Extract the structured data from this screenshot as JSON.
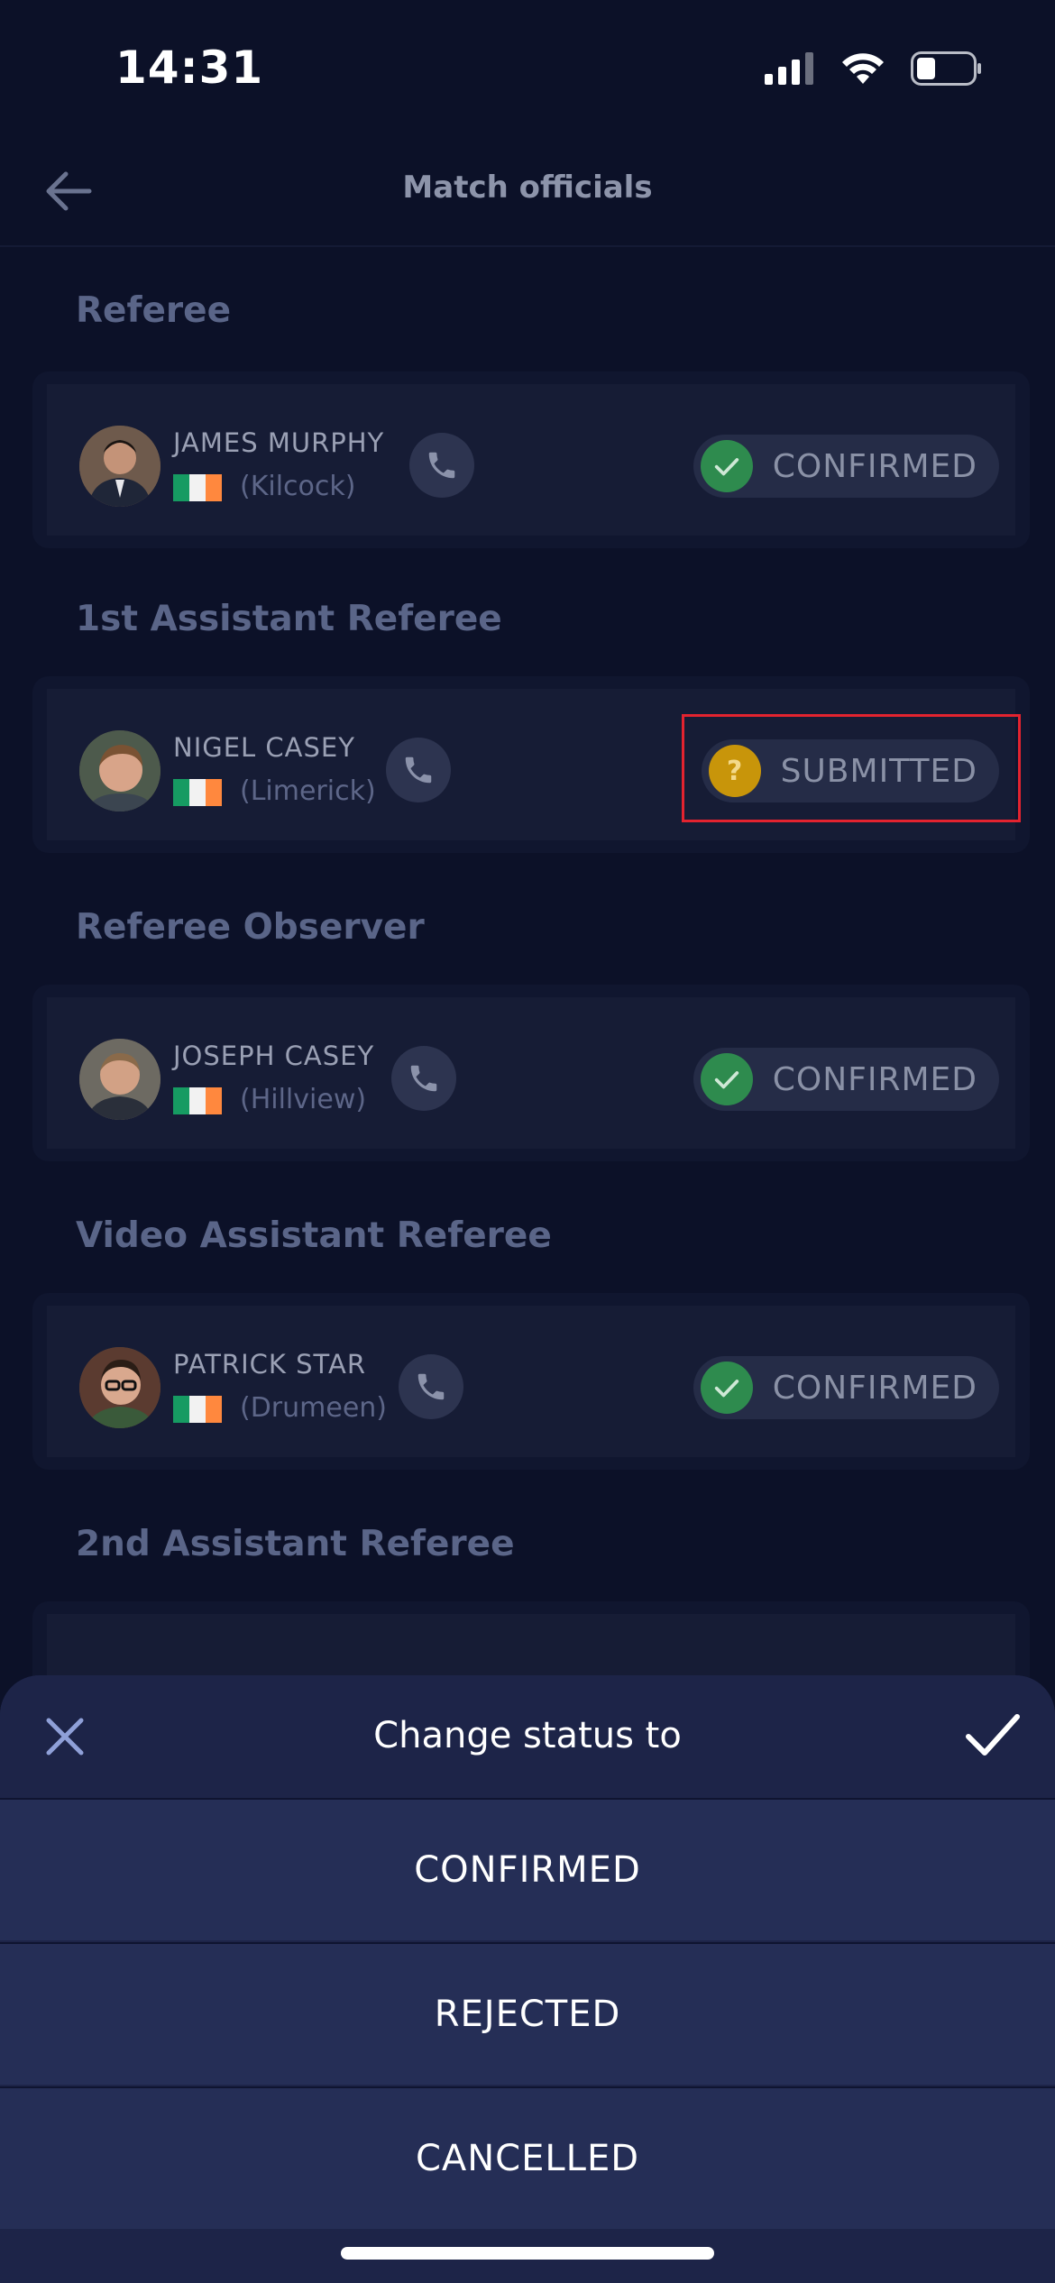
{
  "status_bar": {
    "time": "14:31"
  },
  "header": {
    "title": "Match officials"
  },
  "sections": [
    {
      "label": "Referee",
      "official": {
        "name": "JAMES MURPHY",
        "club": "(Kilcock)",
        "status": "CONFIRMED"
      }
    },
    {
      "label": "1st Assistant Referee",
      "official": {
        "name": "NIGEL CASEY",
        "club": "(Limerick)",
        "status": "SUBMITTED"
      }
    },
    {
      "label": "Referee Observer",
      "official": {
        "name": "JOSEPH CASEY",
        "club": "(Hillview)",
        "status": "CONFIRMED"
      }
    },
    {
      "label": "Video Assistant Referee",
      "official": {
        "name": "PATRICK STAR",
        "club": "(Drumeen)",
        "status": "CONFIRMED"
      }
    },
    {
      "label": "2nd Assistant Referee"
    }
  ],
  "status_icons": {
    "confirmed": "✓",
    "submitted": "?"
  },
  "colors": {
    "confirmed": "#2e8b4e",
    "submitted": "#c8950a",
    "flag_green": "#169b62",
    "flag_white": "#f2f2f2",
    "flag_orange": "#ff883e"
  },
  "sheet": {
    "title": "Change status to",
    "options": [
      "CONFIRMED",
      "REJECTED",
      "CANCELLED"
    ]
  }
}
